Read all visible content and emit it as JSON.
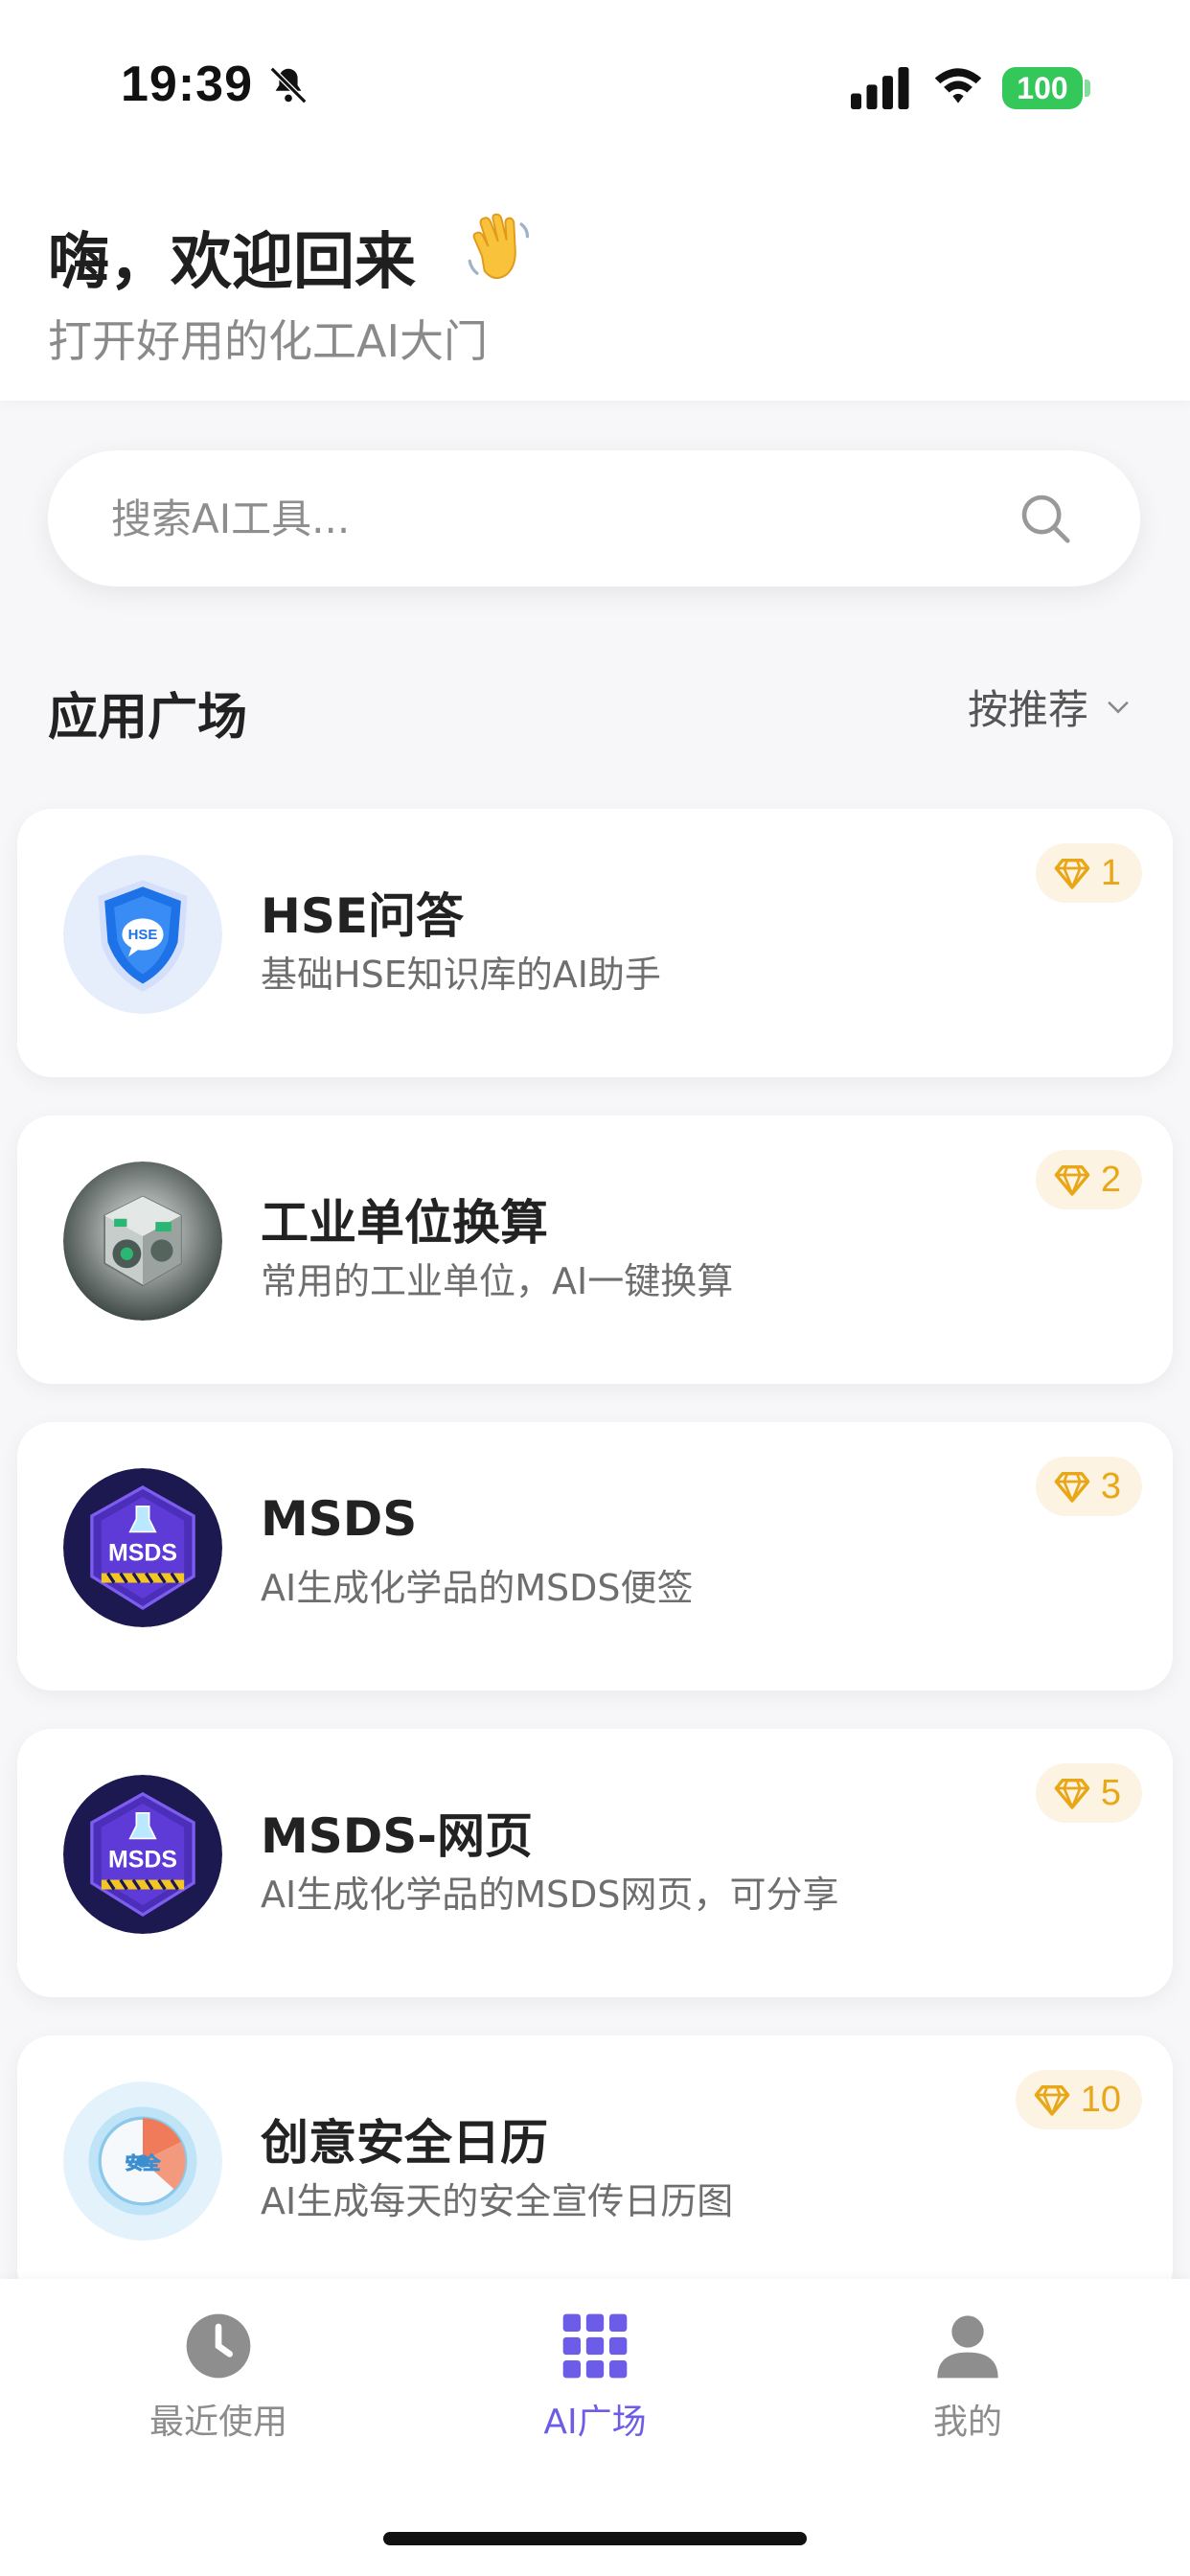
{
  "status_bar": {
    "time": "19:39",
    "battery": "100"
  },
  "header": {
    "greeting": "嗨，欢迎回来",
    "subtitle": "打开好用的化工AI大门"
  },
  "search": {
    "placeholder": "搜索AI工具..."
  },
  "section": {
    "title": "应用广场",
    "sort_label": "按推荐"
  },
  "apps": [
    {
      "title": "HSE问答",
      "description": "基础HSE知识库的AI助手",
      "cost": "1",
      "icon": "hse-shield-icon"
    },
    {
      "title": "工业单位换算",
      "description": "常用的工业单位，AI一键换算",
      "cost": "2",
      "icon": "gear-cube-icon"
    },
    {
      "title": "MSDS",
      "description": "AI生成化学品的MSDS便签",
      "cost": "3",
      "icon": "msds-icon"
    },
    {
      "title": "MSDS-网页",
      "description": "AI生成化学品的MSDS网页，可分享",
      "cost": "5",
      "icon": "msds-icon"
    },
    {
      "title": "创意安全日历",
      "description": "AI生成每天的安全宣传日历图",
      "cost": "10",
      "icon": "safety-dial-icon"
    }
  ],
  "nav": {
    "items": [
      {
        "label": "最近使用",
        "icon": "clock-icon",
        "active": false
      },
      {
        "label": "AI广场",
        "icon": "grid-icon",
        "active": true
      },
      {
        "label": "我的",
        "icon": "person-icon",
        "active": false
      }
    ]
  },
  "colors": {
    "accent": "#6c5ce7",
    "gem": "#e8a717",
    "badge_bg": "#fdf3e3",
    "battery": "#34c759"
  }
}
